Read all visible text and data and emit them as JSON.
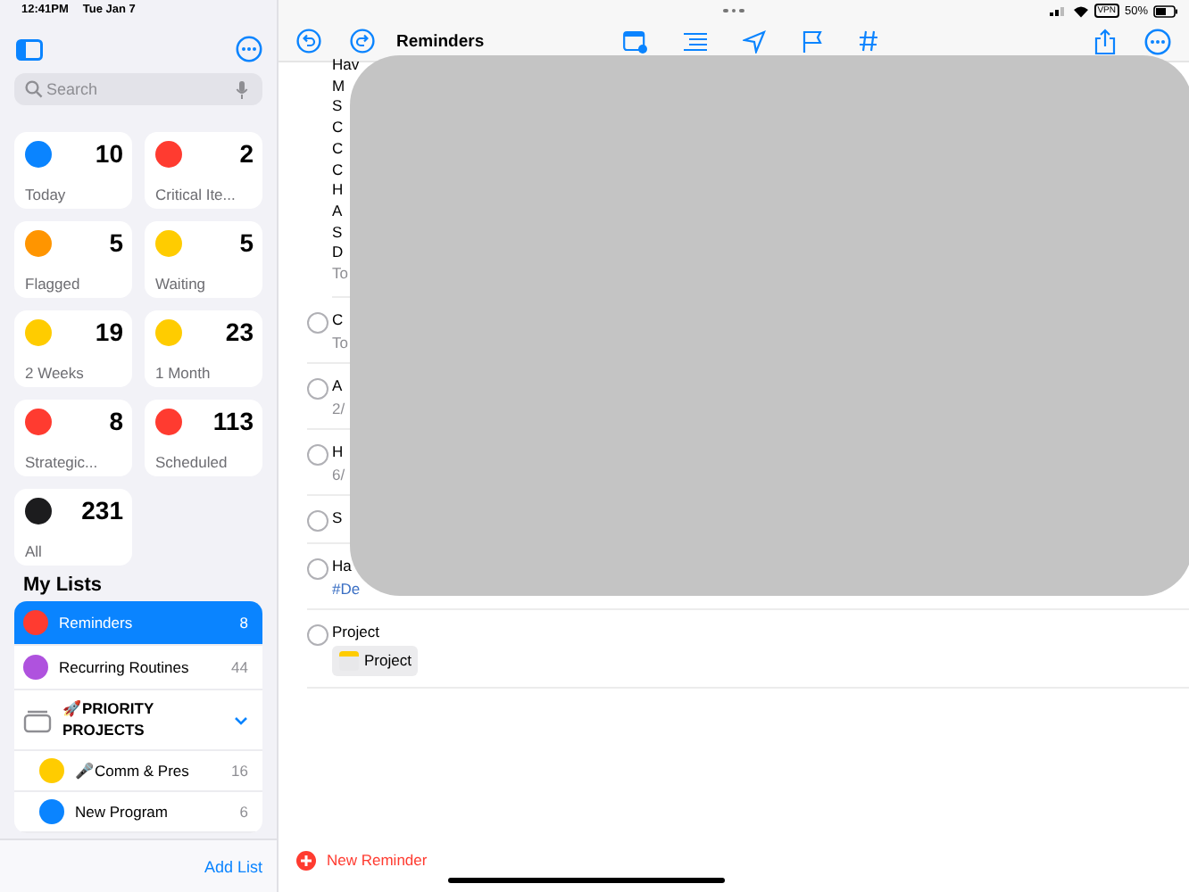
{
  "status_bar": {
    "time": "12:41PM",
    "date": "Tue Jan 7",
    "vpn": "VPN",
    "battery": "50%"
  },
  "sidebar": {
    "search": {
      "placeholder": "Search"
    },
    "smart_lists": [
      {
        "label": "Today",
        "count": "10",
        "color": "#0a84ff"
      },
      {
        "label": "Critical Ite...",
        "count": "2",
        "color": "#ff3b30"
      },
      {
        "label": "Flagged",
        "count": "5",
        "color": "#ff9500"
      },
      {
        "label": "Waiting",
        "count": "5",
        "color": "#ffcc00"
      },
      {
        "label": "2 Weeks",
        "count": "19",
        "color": "#ffcc00"
      },
      {
        "label": "1 Month",
        "count": "23",
        "color": "#ffcc00"
      },
      {
        "label": "Strategic...",
        "count": "8",
        "color": "#ff3b30"
      },
      {
        "label": "Scheduled",
        "count": "113",
        "color": "#ff3b30"
      },
      {
        "label": "All",
        "count": "231",
        "color": "#1c1c1e"
      }
    ],
    "my_lists_heading": "My Lists",
    "lists": [
      {
        "kind": "list",
        "label": "Reminders",
        "count": "8",
        "color": "#ff3b30",
        "selected": true
      },
      {
        "kind": "list",
        "label": "Recurring Routines",
        "count": "44",
        "color": "#af52de",
        "selected": false
      },
      {
        "kind": "group",
        "label": "🚀PRIORITY PROJECTS",
        "expanded": true,
        "selected": false,
        "children": [
          {
            "kind": "list",
            "label": "🎤Comm & Pres",
            "count": "16",
            "color": "#ffcc00",
            "selected": false
          },
          {
            "kind": "list",
            "label": "New Program",
            "count": "6",
            "color": "#0a84ff",
            "selected": false
          }
        ]
      }
    ],
    "add_list": "Add List"
  },
  "main": {
    "title": "Reminders",
    "first_item_lines": [
      "Hav",
      "M",
      "S",
      "C",
      "C",
      "C",
      "H",
      "A",
      "S",
      "D"
    ],
    "first_item_meta": "To",
    "items": [
      {
        "title": "C",
        "meta": "To",
        "kind": "plain"
      },
      {
        "title": "A",
        "meta": "2/",
        "kind": "plain"
      },
      {
        "title": "H",
        "meta": "6/",
        "kind": "plain"
      },
      {
        "title": "S",
        "kind": "plain"
      },
      {
        "title": "Ha",
        "meta": "#De",
        "kind": "tag"
      },
      {
        "title": "Project",
        "meta": "Project",
        "kind": "chip"
      }
    ],
    "new_reminder": "New Reminder"
  }
}
